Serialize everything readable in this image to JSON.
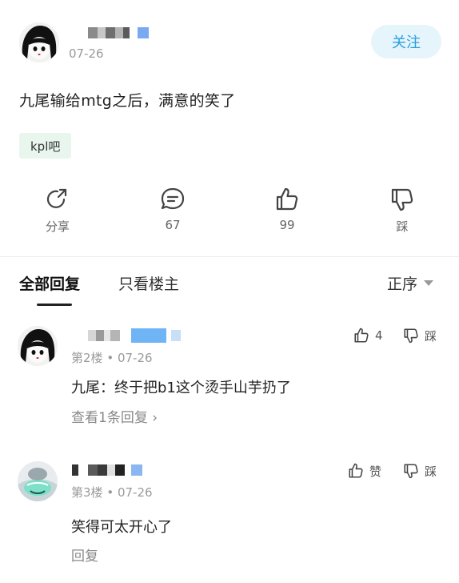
{
  "post": {
    "date": "07-26",
    "follow_label": "关注",
    "text": "九尾输给mtg之后，满意的笑了",
    "tag": "kpl吧"
  },
  "actions": [
    {
      "icon": "share-icon",
      "label": "分享"
    },
    {
      "icon": "comment-icon",
      "label": "67"
    },
    {
      "icon": "thumbs-up-icon",
      "label": "99"
    },
    {
      "icon": "thumbs-down-icon",
      "label": "踩"
    }
  ],
  "tabs": {
    "all": "全部回复",
    "op_only": "只看楼主",
    "sort": "正序"
  },
  "comments": [
    {
      "floor": "第2楼",
      "date": "07-26",
      "likes": "4",
      "dislike": "踩",
      "text": "九尾：终于把b1这个烫手山芋扔了",
      "link": "查看1条回复"
    },
    {
      "floor": "第3楼",
      "date": "07-26",
      "likes": "赞",
      "dislike": "踩",
      "text": "笑得可太开心了",
      "link": "回复"
    }
  ],
  "colors": {
    "accent": "#2aa0e0",
    "follow_bg": "#e6f4fc",
    "tag_bg": "#e8f6ee",
    "muted": "#9a9a9a"
  }
}
